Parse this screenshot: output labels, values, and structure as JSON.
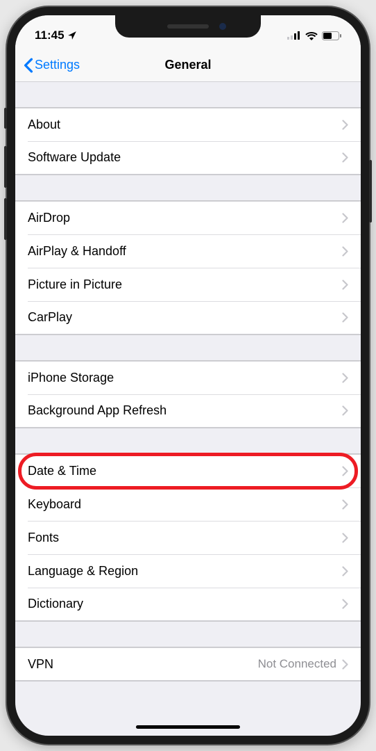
{
  "statusBar": {
    "time": "11:45",
    "locationIcon": "location-arrow"
  },
  "nav": {
    "backLabel": "Settings",
    "title": "General"
  },
  "groups": [
    {
      "rows": [
        {
          "key": "about",
          "label": "About"
        },
        {
          "key": "software-update",
          "label": "Software Update"
        }
      ]
    },
    {
      "rows": [
        {
          "key": "airdrop",
          "label": "AirDrop"
        },
        {
          "key": "airplay-handoff",
          "label": "AirPlay & Handoff"
        },
        {
          "key": "picture-in-picture",
          "label": "Picture in Picture"
        },
        {
          "key": "carplay",
          "label": "CarPlay"
        }
      ]
    },
    {
      "rows": [
        {
          "key": "iphone-storage",
          "label": "iPhone Storage"
        },
        {
          "key": "background-app-refresh",
          "label": "Background App Refresh"
        }
      ]
    },
    {
      "rows": [
        {
          "key": "date-time",
          "label": "Date & Time",
          "highlighted": true
        },
        {
          "key": "keyboard",
          "label": "Keyboard"
        },
        {
          "key": "fonts",
          "label": "Fonts"
        },
        {
          "key": "language-region",
          "label": "Language & Region"
        },
        {
          "key": "dictionary",
          "label": "Dictionary"
        }
      ]
    },
    {
      "rows": [
        {
          "key": "vpn",
          "label": "VPN",
          "detail": "Not Connected"
        }
      ]
    }
  ]
}
